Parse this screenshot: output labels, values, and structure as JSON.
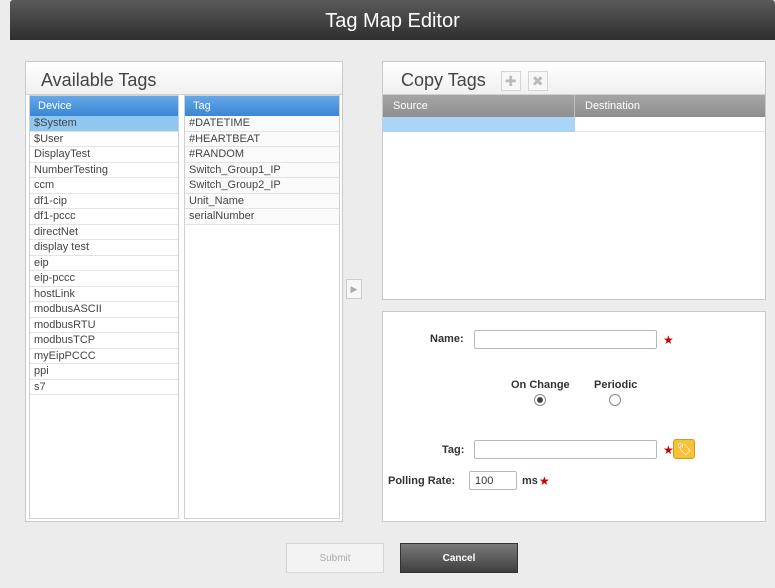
{
  "window": {
    "title": "Tag Map Editor"
  },
  "available_tags": {
    "heading": "Available Tags",
    "device_header": "Device",
    "tag_header": "Tag",
    "devices": [
      "$System",
      "$User",
      "DisplayTest",
      "NumberTesting",
      "ccm",
      "df1-cip",
      "df1-pccc",
      "directNet",
      "display test",
      "eip",
      "eip-pccc",
      "hostLink",
      "modbusASCII",
      "modbusRTU",
      "modbusTCP",
      "myEipPCCC",
      "ppi",
      "s7"
    ],
    "selected_device": "$System",
    "tags": [
      "#DATETIME",
      "#HEARTBEAT",
      "#RANDOM",
      "Switch_Group1_IP",
      "Switch_Group2_IP",
      "Unit_Name",
      "serialNumber"
    ]
  },
  "copy_tags": {
    "heading": "Copy Tags",
    "add_icon": "plus-icon",
    "remove_icon": "close-icon",
    "source_header": "Source",
    "destination_header": "Destination"
  },
  "form": {
    "name_label": "Name:",
    "name_value": "",
    "on_change_label": "On Change",
    "periodic_label": "Periodic",
    "selected_mode": "On Change",
    "tag_label": "Tag:",
    "tag_value": "",
    "polling_label": "Polling Rate:",
    "polling_value": "100",
    "polling_unit": "ms",
    "required_marker": "★",
    "tag_picker_icon": "tag-icon"
  },
  "buttons": {
    "submit": "Submit",
    "cancel": "Cancel"
  },
  "colors": {
    "header_blue": "#3b86d3",
    "selected_row": "#8fc7f0",
    "required": "#cc0000",
    "tag_picker": "#f5c23a"
  }
}
